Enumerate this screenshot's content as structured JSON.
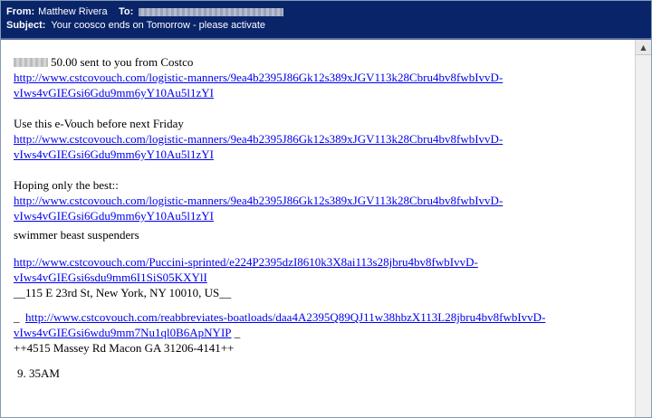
{
  "header": {
    "from_label": "From:",
    "from_value": "Matthew Rivera",
    "to_label": "To:",
    "subject_label": "Subject:",
    "subject_value": "Your coosco ends on Tomorrow - please activate"
  },
  "body": {
    "p1_text": "50.00 sent to you from Costco",
    "link1a": "http://www.cstcovouch.com/logistic-manners/9ea4b2395J86Gk12s389xJGV113k28Cbru4bv8fwbIvvD-",
    "link1b": "vIws4vGIEGsi6Gdu9mm6yY10Au5l1zYI",
    "p2_text": "Use this e-Vouch before next Friday",
    "link2a": "http://www.cstcovouch.com/logistic-manners/9ea4b2395J86Gk12s389xJGV113k28Cbru4bv8fwbIvvD-",
    "link2b": "vIws4vGIEGsi6Gdu9mm6yY10Au5l1zYI",
    "p3_text": "Hoping only the best::",
    "link3a": "http://www.cstcovouch.com/logistic-manners/9ea4b2395J86Gk12s389xJGV113k28Cbru4bv8fwbIvvD-",
    "link3b": "vIws4vGIEGsi6Gdu9mm6yY10Au5l1zYI",
    "p4_text": "swimmer beast suspenders",
    "link4a": "http://www.cstcovouch.com/Puccini-sprinted/e224P2395dzI8610k3X8ai113s28jbru4bv8fwbIvvD-",
    "link4b": "vIws4vGIEGsi6sdu9mm6I1SiS05KXYlI",
    "addr1": "__115 E 23rd St, New York, NY 10010, US__",
    "link5_prefix": "_",
    "link5a": "http://www.cstcovouch.com/reabbreviates-boatloads/daa4A2395Q89QJ11w38hbzX113L28jbru4bv8fwbIvvD-",
    "link5b": "vIws4vGIEGsi6wdu9mm7Nu1ql0B6ApNYIP",
    "link5_suffix": "_",
    "addr2": "++4515 Massey Rd Macon GA 31206-4141++",
    "time_text": "9. 35AM"
  },
  "scrollbar": {
    "up_arrow": "▲"
  }
}
